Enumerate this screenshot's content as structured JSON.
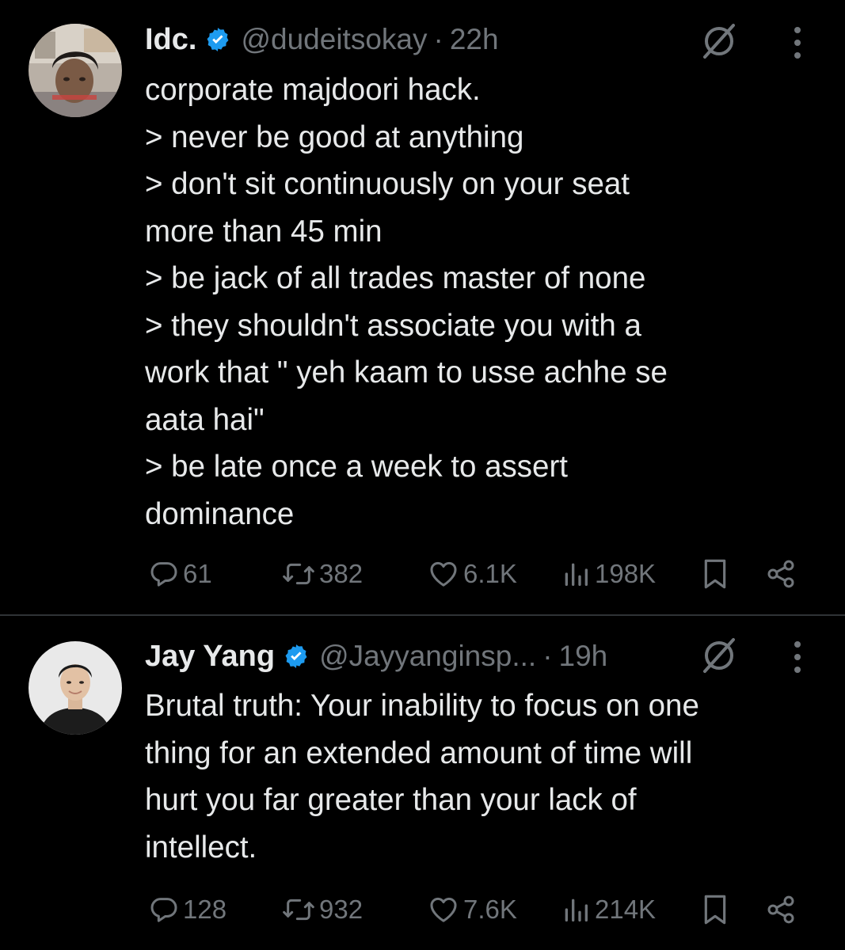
{
  "colors": {
    "background": "#000000",
    "text": "#e7e9ea",
    "muted": "#71767b",
    "verified": "#1d9bf0",
    "divider": "#2f3336"
  },
  "tweets": [
    {
      "display_name": "Idc.",
      "verified_icon": "verified-badge-icon",
      "handle": "@dudeitsokay",
      "separator": "·",
      "time": "22h",
      "lines": [
        "corporate majdoori hack.",
        "> never be good at anything",
        "> don't sit continuously on your seat",
        "more than 45 min",
        "> be jack of all trades master of none",
        "> they shouldn't associate you with a",
        "work that \" yeh kaam to usse achhe se",
        "aata hai\"",
        "> be late once a week to assert",
        "dominance"
      ],
      "replies": "61",
      "reposts": "382",
      "likes": "6.1K",
      "views": "198K"
    },
    {
      "display_name": "Jay Yang",
      "verified_icon": "verified-badge-icon",
      "handle": "@Jayyanginsp...",
      "separator": "·",
      "time": "19h",
      "lines": [
        "Brutal truth: Your inability to focus on one",
        "thing for an extended amount of time will",
        "hurt you far greater than your lack of",
        "intellect."
      ],
      "replies": "128",
      "reposts": "932",
      "likes": "7.6K",
      "views": "214K"
    }
  ]
}
